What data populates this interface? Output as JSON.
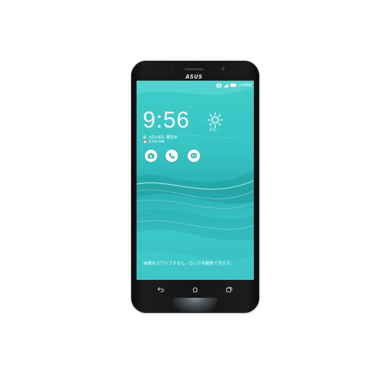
{
  "device": {
    "brand": "ASUS"
  },
  "status_bar": {
    "time": "9:56AM",
    "icons": [
      "notification-icon",
      "signal-icon",
      "battery-icon"
    ]
  },
  "lockscreen": {
    "clock": "9:56",
    "weather_icon": "sun-icon",
    "temperature": "5°C",
    "date": "金, 3月18日, 横浜市",
    "alarm": "⏰ 6:00 AM",
    "shortcuts": [
      {
        "icon": "camera-icon"
      },
      {
        "icon": "phone-icon"
      },
      {
        "icon": "message-icon"
      }
    ],
    "unlock_hint": "画面をスワイプすると、ロックを解除できます。"
  },
  "nav_bar": {
    "keys": [
      "back-icon",
      "home-icon",
      "recent-apps-icon"
    ]
  },
  "colors": {
    "screen_accent": "#37c4c2",
    "body": "#151515"
  }
}
